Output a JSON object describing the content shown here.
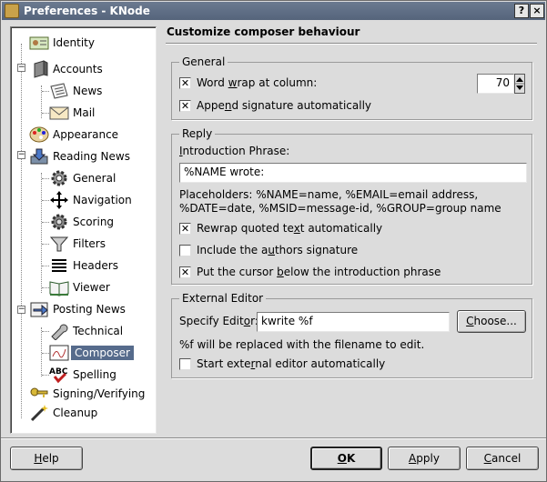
{
  "window": {
    "title": "Preferences - KNode",
    "help_btn": "?",
    "close_btn": "×"
  },
  "tree": {
    "items": [
      {
        "label": "Identity",
        "icon": "identity-icon"
      },
      {
        "label": "Accounts",
        "icon": "accounts-icon"
      },
      {
        "label": "News",
        "icon": "news-icon"
      },
      {
        "label": "Mail",
        "icon": "mail-icon"
      },
      {
        "label": "Appearance",
        "icon": "appearance-icon"
      },
      {
        "label": "Reading News",
        "icon": "reading-news-icon"
      },
      {
        "label": "General",
        "icon": "gear-icon"
      },
      {
        "label": "Navigation",
        "icon": "navigation-arrows-icon"
      },
      {
        "label": "Scoring",
        "icon": "scoring-gear-icon"
      },
      {
        "label": "Filters",
        "icon": "filter-funnel-icon"
      },
      {
        "label": "Headers",
        "icon": "headers-icon"
      },
      {
        "label": "Viewer",
        "icon": "viewer-book-icon"
      },
      {
        "label": "Posting News",
        "icon": "posting-news-icon"
      },
      {
        "label": "Technical",
        "icon": "technical-icon"
      },
      {
        "label": "Composer",
        "icon": "composer-icon"
      },
      {
        "label": "Spelling",
        "icon": "spelling-icon"
      },
      {
        "label": "Signing/Verifying",
        "icon": "key-icon"
      },
      {
        "label": "Cleanup",
        "icon": "cleanup-wand-icon"
      }
    ]
  },
  "page": {
    "title": "Customize composer behaviour"
  },
  "general": {
    "legend": "General",
    "word_wrap_label": "Word wrap at column:",
    "word_wrap_checked": true,
    "wrap_column": "70",
    "append_sig_label": "Append signature automatically",
    "append_sig_checked": true
  },
  "reply": {
    "legend": "Reply",
    "intro_label": "Introduction Phrase:",
    "intro_value": "%NAME wrote:",
    "placeholders_line1": "Placeholders: %NAME=name, %EMAIL=email address,",
    "placeholders_line2": "%DATE=date, %MSID=message-id, %GROUP=group name",
    "rewrap_label": "Rewrap quoted text automatically",
    "rewrap_checked": true,
    "include_sig_label": "Include the authors signature",
    "include_sig_checked": false,
    "cursor_below_label": "Put the cursor below the introduction phrase",
    "cursor_below_checked": true
  },
  "editor": {
    "legend": "External Editor",
    "specify_label": "Specify Editor:",
    "editor_value": "kwrite %f",
    "choose_label": "Choose...",
    "note": "%f will be replaced with the filename to edit.",
    "start_auto_label": "Start external editor automatically",
    "start_auto_checked": false
  },
  "buttons": {
    "help": "Help",
    "ok": "OK",
    "apply": "Apply",
    "cancel": "Cancel"
  }
}
